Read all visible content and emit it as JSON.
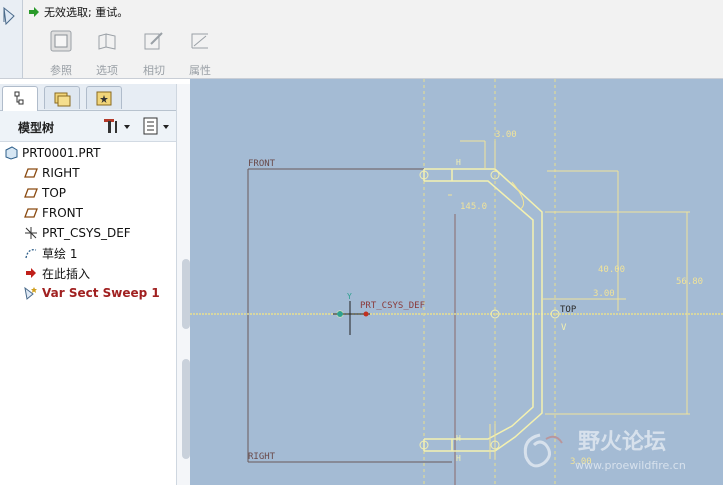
{
  "dashboard": {
    "message": "无效选取; 重试。",
    "tools": [
      {
        "label": "参照"
      },
      {
        "label": "选项"
      },
      {
        "label": "相切"
      },
      {
        "label": "属性"
      }
    ]
  },
  "model_tree": {
    "title": "模型树",
    "nodes": [
      {
        "label": "PRT0001.PRT"
      },
      {
        "label": "RIGHT"
      },
      {
        "label": "TOP"
      },
      {
        "label": "FRONT"
      },
      {
        "label": "PRT_CSYS_DEF"
      },
      {
        "label": "草绘 1"
      },
      {
        "label": "在此插入"
      },
      {
        "label": "Var Sect Sweep 1"
      }
    ]
  },
  "graphics": {
    "labels": {
      "front": "FRONT",
      "right": "RIGHT",
      "top": "TOP",
      "csys": "PRT_CSYS_DEF",
      "csys_y": "Y",
      "top_v": "V",
      "h1": "H",
      "h2": "H",
      "h3": "H",
      "dim_3_top": "3.00",
      "dim_145": "145.0",
      "dim_40": "40.00",
      "dim_3_mid": "3.00",
      "dim_56": "56.80",
      "dim_3_bot": "3.00"
    },
    "watermark": {
      "title": "野火论坛",
      "url": "www.proewildfire.cn"
    },
    "colors": {
      "background": "#a4bbd4",
      "datum": "#e8df8e",
      "sketch": "#f4f1b0",
      "dim": "#f0e39a"
    }
  }
}
